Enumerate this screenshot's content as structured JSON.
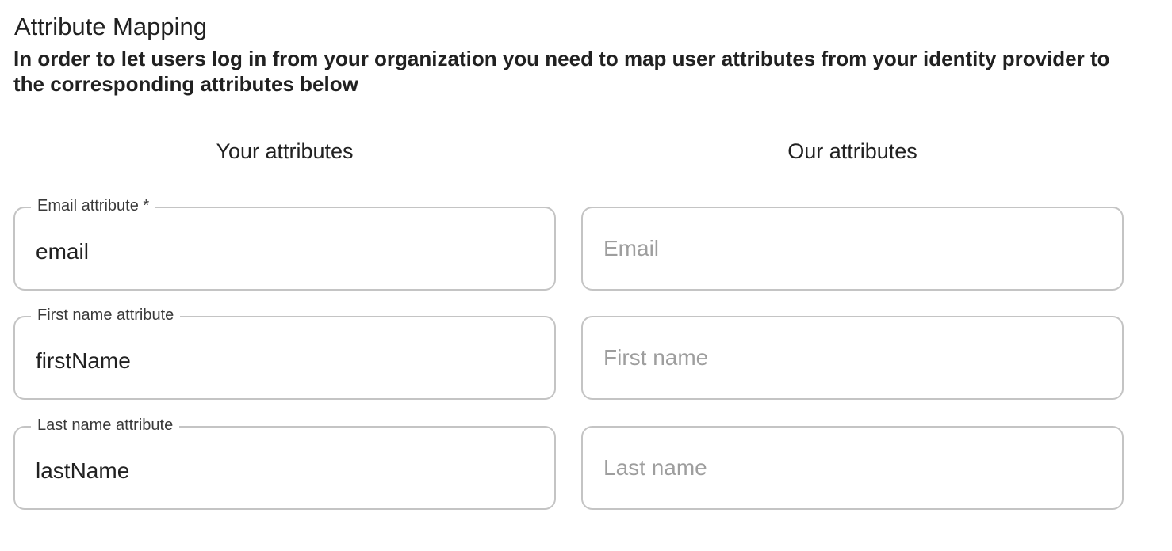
{
  "section": {
    "title": "Attribute Mapping",
    "description": "In order to let users log in from your organization you need to map user attributes from your identity provider to the corresponding attributes below"
  },
  "columns": {
    "left_header": "Your attributes",
    "right_header": "Our attributes"
  },
  "fields": [
    {
      "label": "Email attribute *",
      "value": "email",
      "our_placeholder": "Email"
    },
    {
      "label": "First name attribute",
      "value": "firstName",
      "our_placeholder": "First name"
    },
    {
      "label": "Last name attribute",
      "value": "lastName",
      "our_placeholder": "Last name"
    }
  ],
  "colors": {
    "border": "#c4c4c4",
    "text": "#212121",
    "placeholder": "#9e9e9e"
  }
}
